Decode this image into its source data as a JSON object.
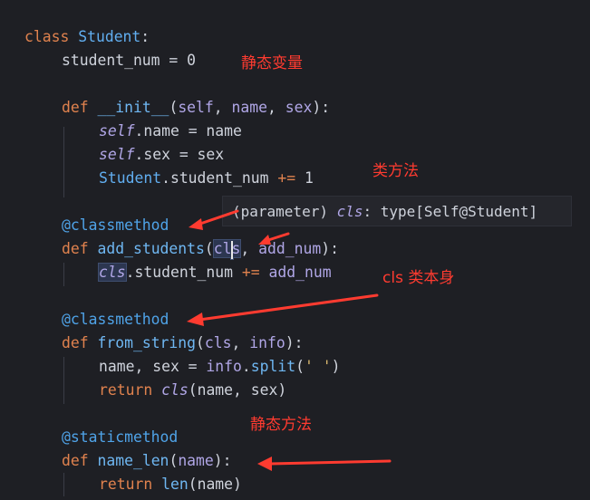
{
  "code": {
    "l1": {
      "kw": "class",
      "name": "Student",
      "colon": ":"
    },
    "l2": {
      "var": "student_num",
      "eq": " = ",
      "val": "0"
    },
    "l3": {
      "kw": "def",
      "name": "__init__",
      "open": "(",
      "p1": "self",
      "sep1": ", ",
      "p2": "name",
      "sep2": ", ",
      "p3": "sex",
      "close": "):"
    },
    "l4": {
      "self": "self",
      "rest": ".name = name"
    },
    "l5": {
      "self": "self",
      "rest": ".sex = sex"
    },
    "l6": {
      "cls": "Student",
      "rest": ".student_num ",
      "op": "+=",
      "val": " 1"
    },
    "l7": {
      "dec": "@classmethod"
    },
    "l8": {
      "kw": "def",
      "name": "add_students",
      "open": "(",
      "p1a": "cl",
      "p1b": "s",
      "sep": ", ",
      "p2": "add_num",
      "close": "):"
    },
    "l9": {
      "cls": "cls",
      "rest": ".student_num ",
      "op": "+=",
      "arg": " add_num"
    },
    "l10": {
      "dec": "@classmethod"
    },
    "l11": {
      "kw": "def",
      "name": "from_string",
      "open": "(",
      "p1": "cls",
      "sep": ", ",
      "p2": "info",
      "close": "):"
    },
    "l12": {
      "a": "name, sex = ",
      "obj": "info",
      "dot": ".",
      "fn": "split",
      "open": "(",
      "str": "' '",
      "close": ")"
    },
    "l13": {
      "kw": "return",
      "cls": "cls",
      "rest": "(name, sex)"
    },
    "l14": {
      "dec": "@staticmethod"
    },
    "l15": {
      "kw": "def",
      "name": "name_len",
      "open": "(",
      "p1": "name",
      "close": "):"
    },
    "l16": {
      "kw": "return",
      "fn": "len",
      "rest": "(name)"
    }
  },
  "tooltip": {
    "prefix": "(parameter) ",
    "param": "cls",
    "suffix": ": type[Self@Student]"
  },
  "annotations": {
    "static_var": "静态变量",
    "class_method": "类方法",
    "cls_itself": "cls 类本身",
    "static_method": "静态方法"
  },
  "colors": {
    "annotation": "#ff3b30",
    "background": "#1e1f24"
  }
}
